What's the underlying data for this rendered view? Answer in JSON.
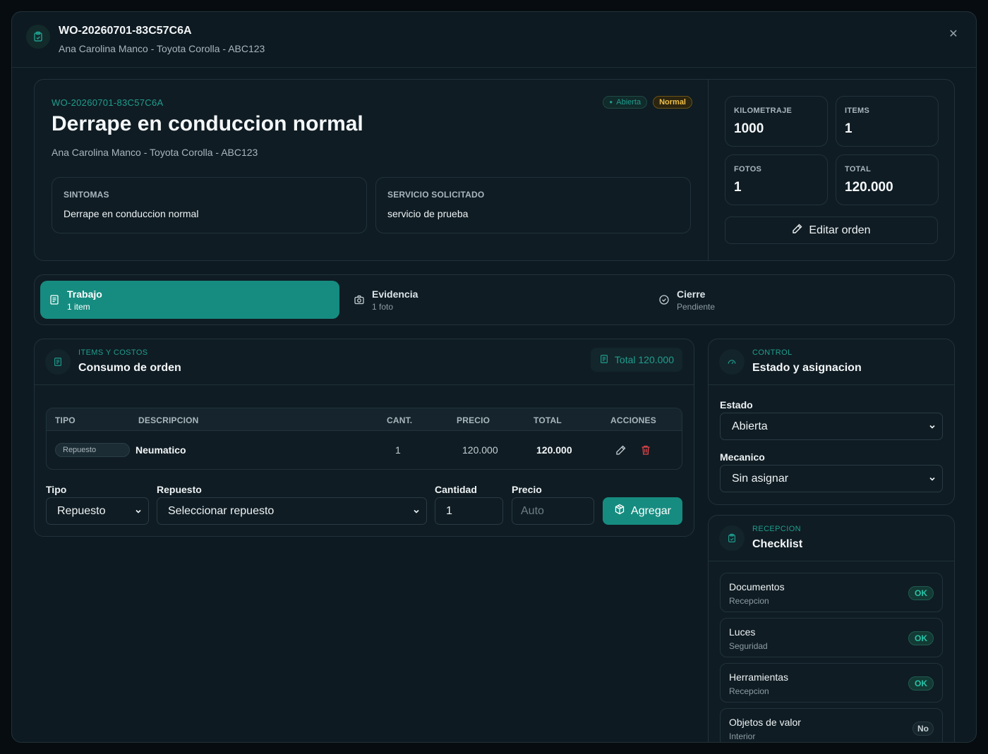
{
  "header": {
    "title": "WO-20260701-83C57C6A",
    "subtitle": "Ana Carolina Manco - Toyota Corolla - ABC123",
    "close_icon": "close-icon"
  },
  "summary": {
    "code": "WO-20260701-83C57C6A",
    "status_badge": "Abierta",
    "priority_badge": "Normal",
    "title": "Derrape en conduccion normal",
    "subtitle": "Ana Carolina Manco - Toyota Corolla - ABC123",
    "symptoms_label": "SINTOMAS",
    "symptoms_value": "Derrape en conduccion normal",
    "service_label": "SERVICIO SOLICITADO",
    "service_value": "servicio de prueba"
  },
  "stats": {
    "km_label": "KILOMETRAJE",
    "km_value": "1000",
    "items_label": "ITEMS",
    "items_value": "1",
    "photos_label": "FOTOS",
    "photos_value": "1",
    "total_label": "TOTAL",
    "total_value": "120.000",
    "edit_button": "Editar orden"
  },
  "tabs": [
    {
      "title": "Trabajo",
      "sub": "1 item"
    },
    {
      "title": "Evidencia",
      "sub": "1 foto"
    },
    {
      "title": "Cierre",
      "sub": "Pendiente"
    }
  ],
  "items_panel": {
    "kicker": "ITEMS Y COSTOS",
    "title": "Consumo de orden",
    "total_pill": "Total 120.000",
    "columns": [
      "TIPO",
      "DESCRIPCION",
      "CANT.",
      "PRECIO",
      "TOTAL",
      "ACCIONES"
    ],
    "rows": [
      {
        "tipo": "Repuesto",
        "descripcion": "Neumatico",
        "cant": "1",
        "precio": "120.000",
        "total": "120.000"
      }
    ],
    "form": {
      "tipo_label": "Tipo",
      "tipo_value": "Repuesto",
      "repuesto_label": "Repuesto",
      "repuesto_value": "Seleccionar repuesto",
      "cantidad_label": "Cantidad",
      "cantidad_value": "1",
      "precio_label": "Precio",
      "precio_placeholder": "Auto",
      "add_button": "Agregar"
    }
  },
  "control_panel": {
    "kicker": "CONTROL",
    "title": "Estado y asignacion",
    "estado_label": "Estado",
    "estado_value": "Abierta",
    "mecanico_label": "Mecanico",
    "mecanico_value": "Sin asignar"
  },
  "checklist_panel": {
    "kicker": "RECEPCION",
    "title": "Checklist",
    "items": [
      {
        "name": "Documentos",
        "section": "Recepcion",
        "status": "OK"
      },
      {
        "name": "Luces",
        "section": "Seguridad",
        "status": "OK"
      },
      {
        "name": "Herramientas",
        "section": "Recepcion",
        "status": "OK"
      },
      {
        "name": "Objetos de valor",
        "section": "Interior",
        "status": "No"
      }
    ]
  },
  "colors": {
    "accent": "#168c80",
    "accent_text": "#1f9e8f",
    "warning": "#f0c04a",
    "danger": "#e0474c",
    "background": "#0e1a21"
  }
}
